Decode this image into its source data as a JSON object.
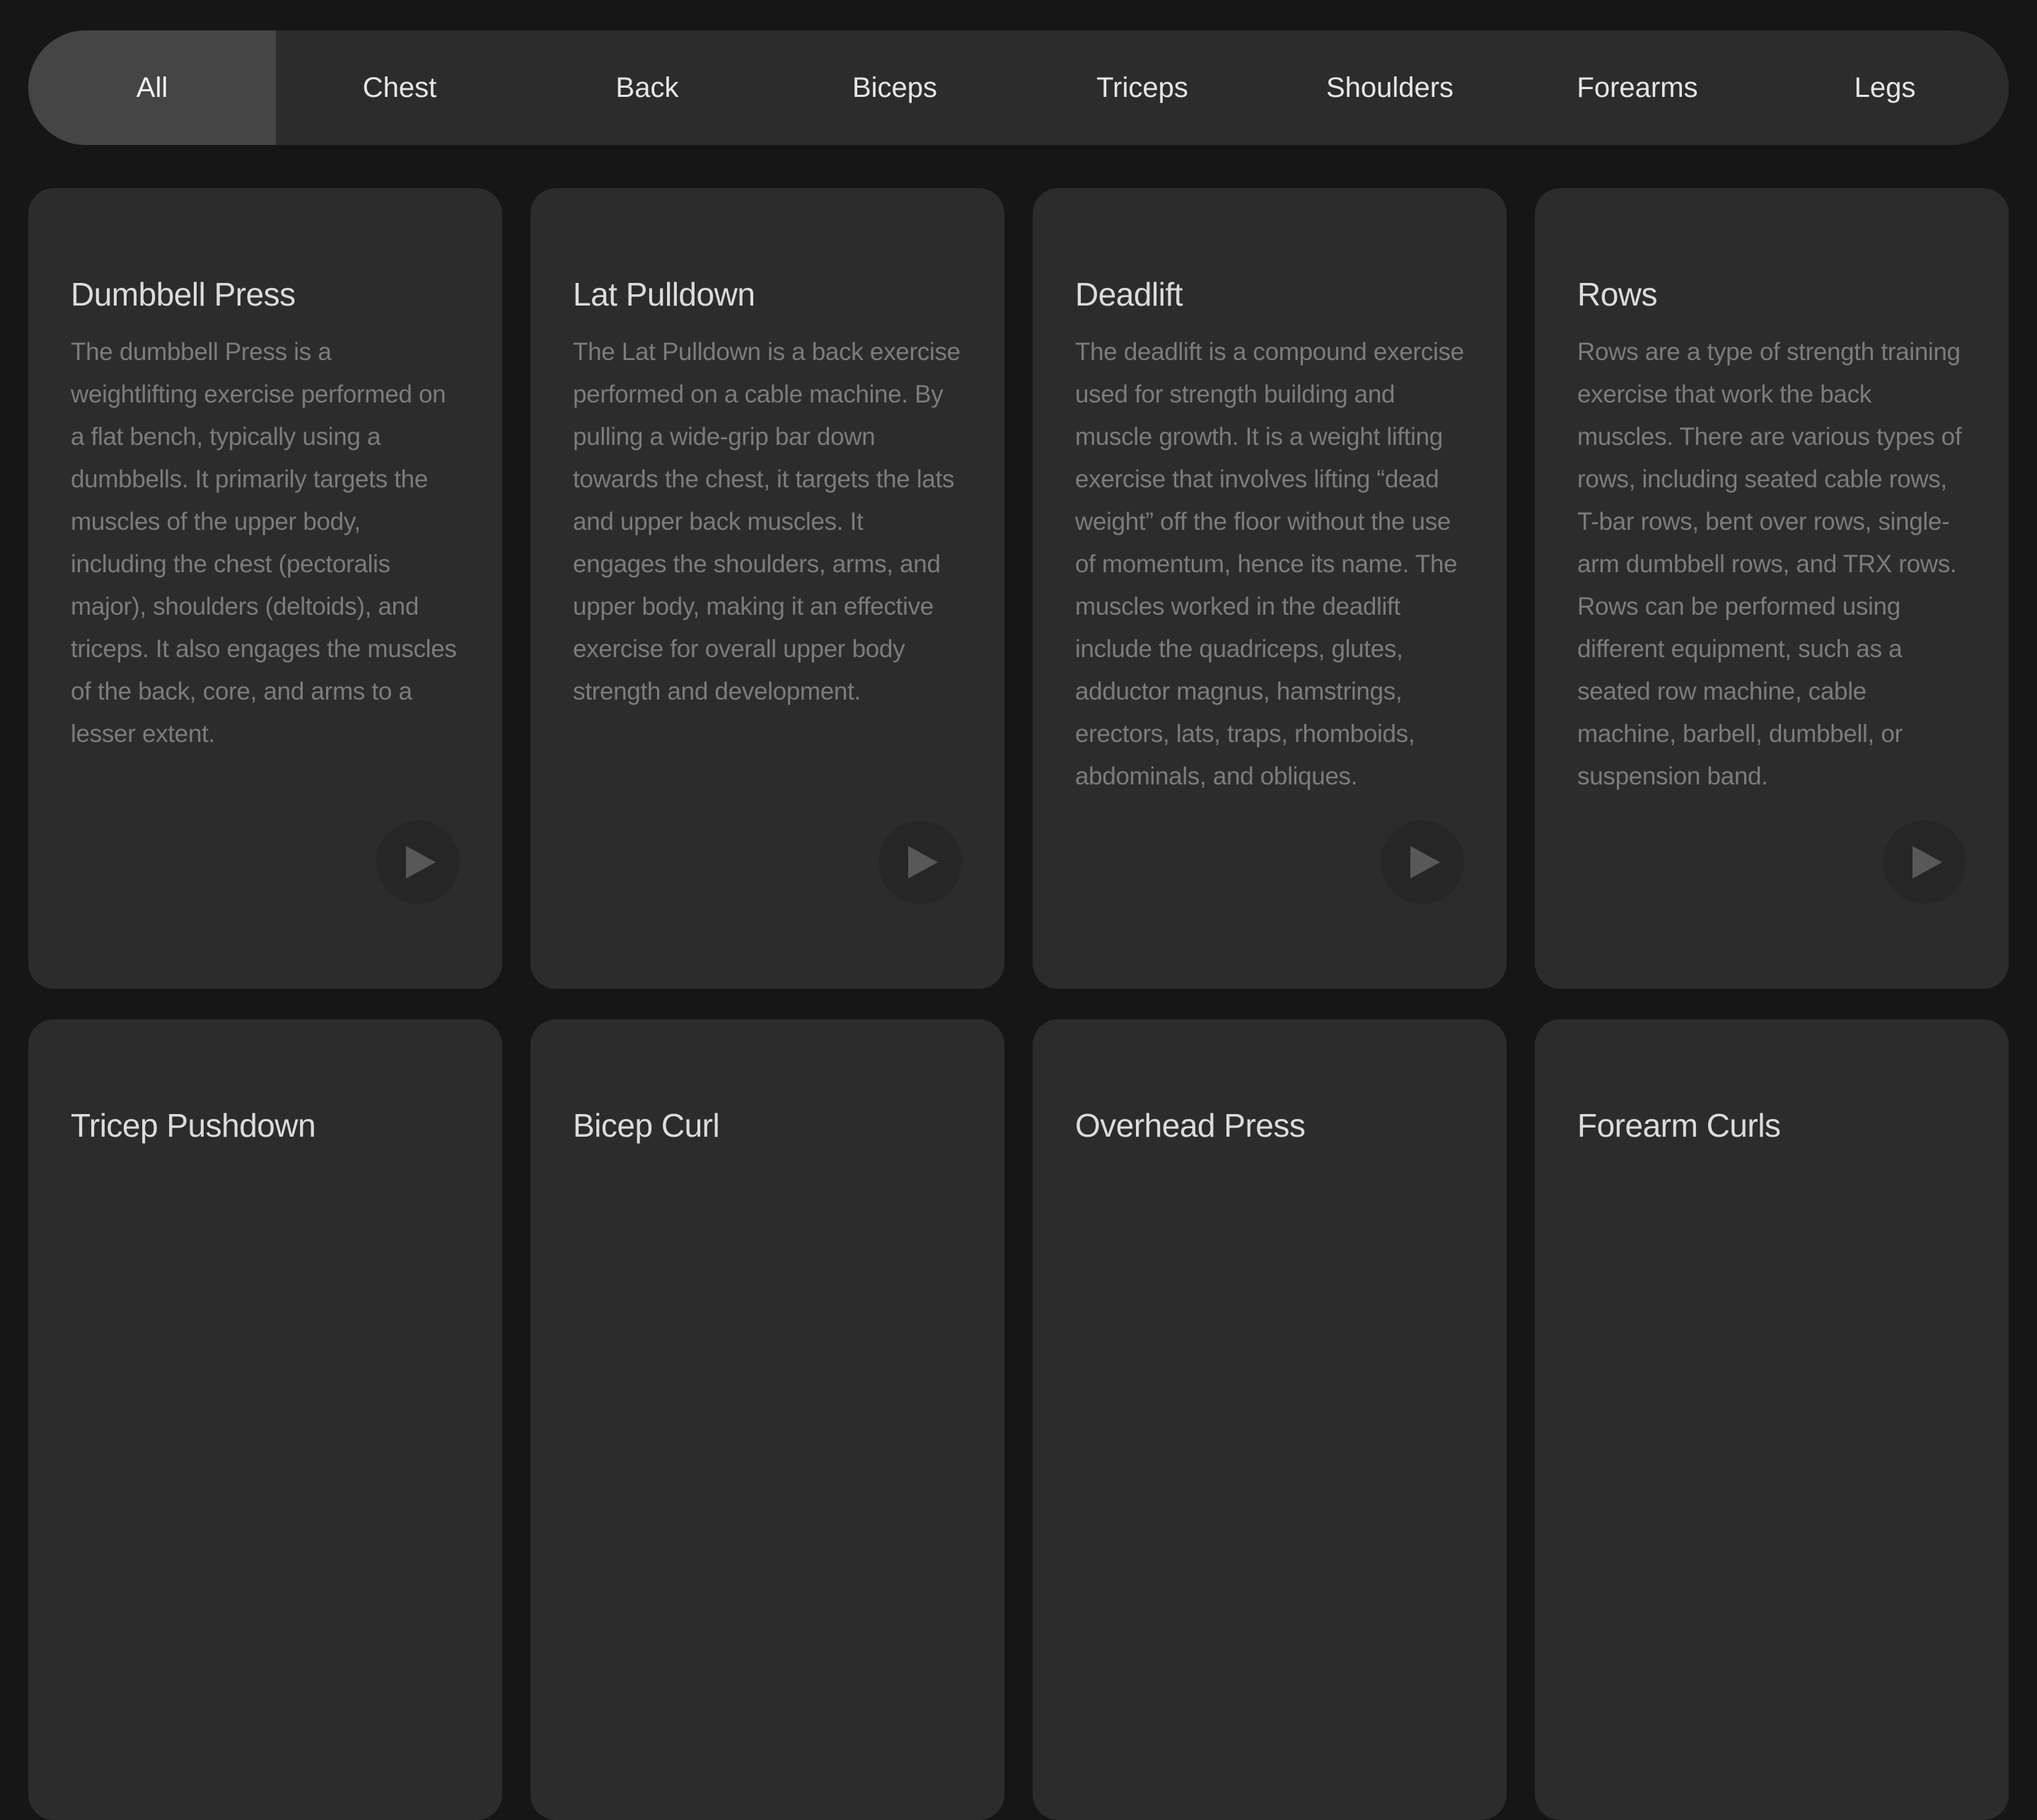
{
  "tabs": [
    {
      "label": "All",
      "active": true
    },
    {
      "label": "Chest"
    },
    {
      "label": "Back"
    },
    {
      "label": "Biceps"
    },
    {
      "label": "Triceps"
    },
    {
      "label": "Shoulders"
    },
    {
      "label": "Forearms"
    },
    {
      "label": "Legs"
    }
  ],
  "cards": [
    {
      "title": "Dumbbell Press",
      "description": "The dumbbell Press is a weightlifting exercise performed on a flat bench, typically using a dumbbells. It primarily targets the muscles of the upper body, including the chest (pectoralis major), shoulders (deltoids), and triceps. It also engages the muscles of the back, core, and arms to a lesser extent."
    },
    {
      "title": "Lat Pulldown",
      "description": "The Lat Pulldown is a back exercise performed on a cable machine. By pulling a wide-grip bar down towards the chest, it targets the lats and upper back muscles. It engages the shoulders, arms, and upper body, making it an effective exercise for overall upper body strength and development."
    },
    {
      "title": "Deadlift",
      "description": "The deadlift is a compound exercise used for strength building and muscle growth. It is a weight lifting exercise that involves lifting “dead weight” off the floor without the use of momentum, hence its name. The muscles worked in the deadlift include the quadriceps, glutes, adductor magnus, hamstrings, erectors, lats, traps, rhomboids, abdominals, and obliques."
    },
    {
      "title": "Rows",
      "description": "Rows are a type of strength training exercise that work the back muscles. There are various types of rows, including seated cable rows, T-bar rows, bent over rows, single-arm dumbbell rows, and TRX rows. Rows can be performed using different equipment, such as a seated row machine, cable machine, barbell, dumbbell, or suspension band."
    },
    {
      "title": "Tricep Pushdown",
      "description": ""
    },
    {
      "title": "Bicep Curl",
      "description": ""
    },
    {
      "title": "Overhead Press",
      "description": ""
    },
    {
      "title": "Forearm Curls",
      "description": ""
    }
  ],
  "icons": {
    "play": "play-icon"
  },
  "colors": {
    "background": "#161616",
    "surface": "#2c2c2c",
    "active_tab": "#454545"
  }
}
